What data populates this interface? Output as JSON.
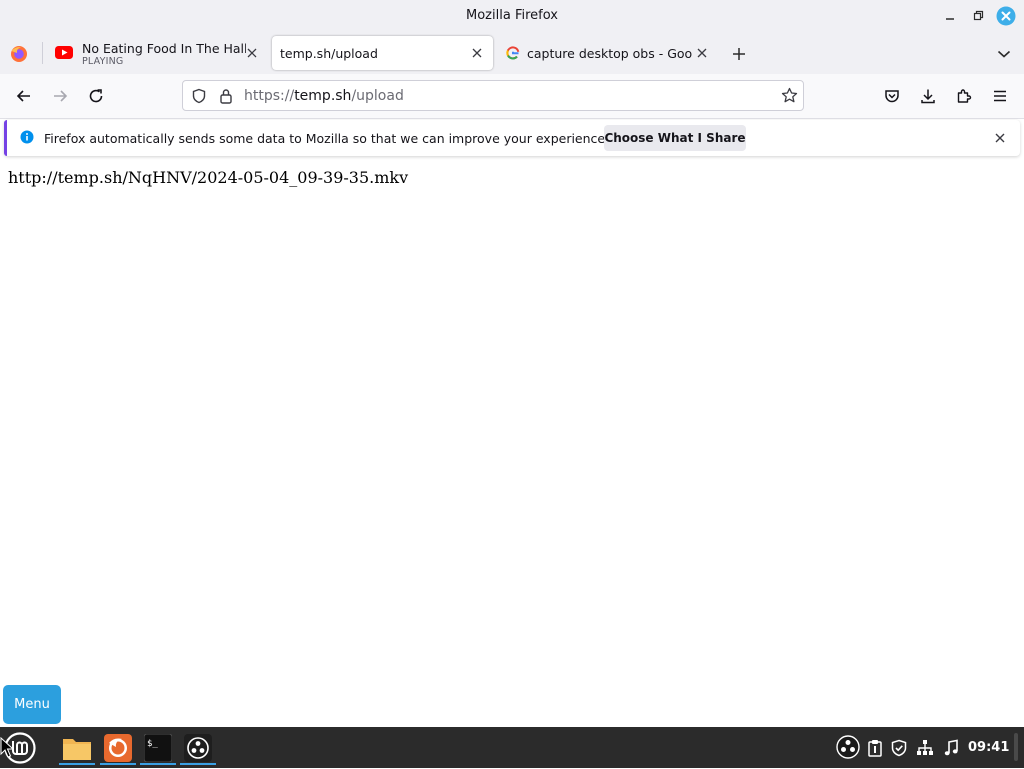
{
  "window": {
    "title": "Mozilla Firefox"
  },
  "tabs": [
    {
      "title": "No Eating Food In The Halls",
      "subtitle": "PLAYING",
      "favicon": "youtube-icon"
    },
    {
      "title": "temp.sh/upload",
      "favicon": "none",
      "active": true
    },
    {
      "title": "capture desktop obs - Goog",
      "favicon": "google-icon"
    }
  ],
  "url": {
    "scheme": "https://",
    "host": "temp.sh",
    "path": "/upload"
  },
  "notification": {
    "message": "Firefox automatically sends some data to Mozilla so that we can improve your experience.",
    "button_label": "Choose What I Share"
  },
  "page": {
    "text": "http://temp.sh/NqHNV/2024-05-04_09-39-35.mkv"
  },
  "desktop": {
    "menu_label": "Menu"
  },
  "taskbar": {
    "apps": [
      "files-icon",
      "firefox-icon",
      "terminal-icon",
      "obs-icon"
    ],
    "tray": [
      "obs-tray-icon",
      "clipboard-icon",
      "shield-icon",
      "network-icon",
      "music-icon"
    ],
    "clock": "09:41"
  },
  "colors": {
    "accent": "#2c9fde",
    "taskbar": "#2b2b2b",
    "close_button": "#3daee9",
    "notification_accent": "#7542e5"
  }
}
